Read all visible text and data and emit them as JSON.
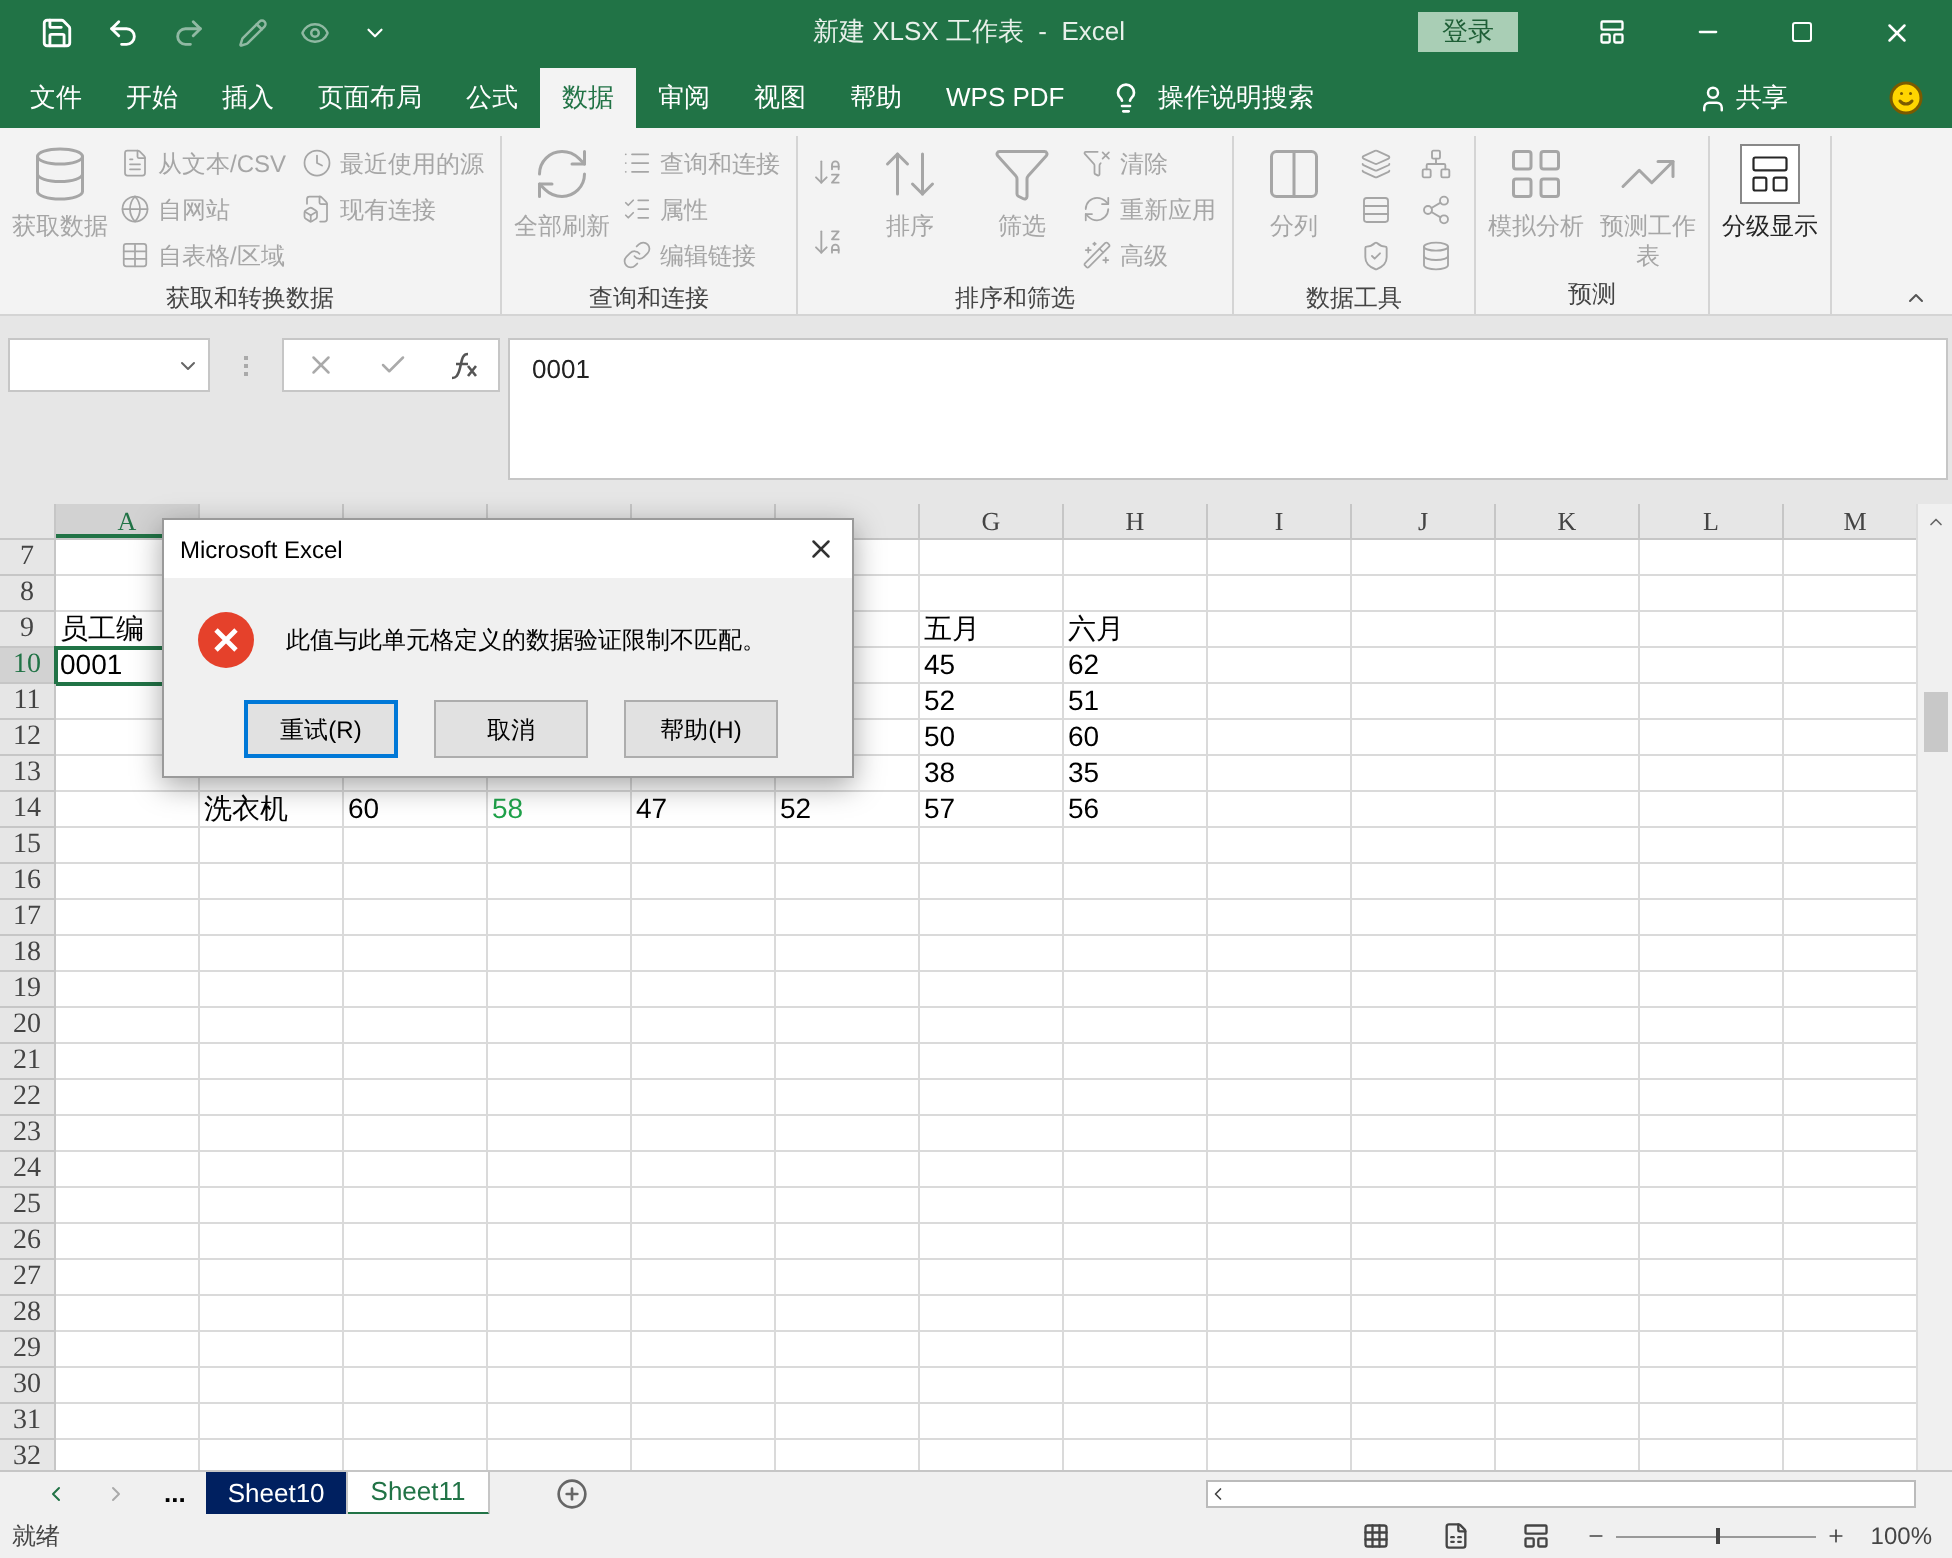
{
  "window": {
    "title": "新建 XLSX 工作表  -  Excel",
    "login": "登录"
  },
  "tabs": [
    {
      "label": "文件",
      "selected": false
    },
    {
      "label": "开始",
      "selected": false
    },
    {
      "label": "插入",
      "selected": false
    },
    {
      "label": "页面布局",
      "selected": false
    },
    {
      "label": "公式",
      "selected": false
    },
    {
      "label": "数据",
      "selected": true
    },
    {
      "label": "审阅",
      "selected": false
    },
    {
      "label": "视图",
      "selected": false
    },
    {
      "label": "帮助",
      "selected": false
    },
    {
      "label": "WPS PDF",
      "selected": false
    }
  ],
  "tell_me": "操作说明搜索",
  "share": "共享",
  "ribbon_groups": [
    {
      "label": "获取和转换数据",
      "items": [
        {
          "kind": "large",
          "label": "获取数据",
          "disabled": true
        },
        {
          "kind": "small",
          "label": "从文本/CSV",
          "disabled": true
        },
        {
          "kind": "small",
          "label": "自网站",
          "disabled": true
        },
        {
          "kind": "small",
          "label": "自表格/区域",
          "disabled": true
        },
        {
          "kind": "small",
          "label": "最近使用的源",
          "disabled": true
        },
        {
          "kind": "small",
          "label": "现有连接",
          "disabled": true
        }
      ]
    },
    {
      "label": "查询和连接",
      "items": [
        {
          "kind": "large",
          "label": "全部刷新",
          "disabled": true
        },
        {
          "kind": "small",
          "label": "查询和连接",
          "disabled": true
        },
        {
          "kind": "small",
          "label": "属性",
          "disabled": true
        },
        {
          "kind": "small",
          "label": "编辑链接",
          "disabled": true
        }
      ]
    },
    {
      "label": "排序和筛选",
      "items": [
        {
          "kind": "icon",
          "disabled": true
        },
        {
          "kind": "icon",
          "disabled": true
        },
        {
          "kind": "large",
          "label": "排序",
          "disabled": true
        },
        {
          "kind": "large",
          "label": "筛选",
          "disabled": true
        },
        {
          "kind": "small",
          "label": "清除",
          "disabled": true
        },
        {
          "kind": "small",
          "label": "重新应用",
          "disabled": true
        },
        {
          "kind": "small",
          "label": "高级",
          "disabled": true
        }
      ]
    },
    {
      "label": "数据工具",
      "items": [
        {
          "kind": "large",
          "label": "分列",
          "disabled": true
        },
        {
          "kind": "icon",
          "disabled": true
        },
        {
          "kind": "icon",
          "disabled": true
        },
        {
          "kind": "icon",
          "disabled": true
        },
        {
          "kind": "icon",
          "disabled": true
        },
        {
          "kind": "icon",
          "disabled": true
        },
        {
          "kind": "icon",
          "disabled": true
        }
      ]
    },
    {
      "label": "预测",
      "items": [
        {
          "kind": "large",
          "label": "模拟分析",
          "disabled": true
        },
        {
          "kind": "large",
          "label": "预测工作表",
          "disabled": true
        }
      ]
    },
    {
      "items": [
        {
          "kind": "large",
          "label": "分级显示",
          "disabled": false
        }
      ]
    }
  ],
  "formula_bar": {
    "value": "0001"
  },
  "columns": [
    {
      "label": "A",
      "selected": true
    },
    {
      "selected": false
    },
    {
      "selected": false
    },
    {
      "selected": false
    },
    {
      "selected": false
    },
    {
      "selected": false
    },
    {
      "label": "G",
      "selected": false
    },
    {
      "label": "H",
      "selected": false
    },
    {
      "label": "I",
      "selected": false
    },
    {
      "label": "J",
      "selected": false
    },
    {
      "label": "K",
      "selected": false
    },
    {
      "label": "L",
      "selected": false
    },
    {
      "label": "M",
      "selected": false
    }
  ],
  "rows": [
    {
      "number": "7",
      "selected": false,
      "cells": {}
    },
    {
      "number": "8",
      "selected": false,
      "cells": {}
    },
    {
      "number": "9",
      "selected": false,
      "cells": {
        "A": {
          "text": "员工编",
          "selected": false
        },
        "G": {
          "text": "五月",
          "selected": false
        },
        "H": {
          "text": "六月",
          "selected": false
        }
      }
    },
    {
      "number": "10",
      "selected": true,
      "cells": {
        "A": {
          "text": "0001",
          "selected": true
        },
        "G": {
          "text": "45",
          "selected": false
        },
        "H": {
          "text": "62",
          "selected": false
        }
      }
    },
    {
      "number": "11",
      "selected": false,
      "cells": {
        "G": {
          "text": "52",
          "selected": false
        },
        "H": {
          "text": "51",
          "selected": false
        }
      }
    },
    {
      "number": "12",
      "selected": false,
      "cells": {
        "G": {
          "text": "50",
          "selected": false
        },
        "H": {
          "text": "60",
          "selected": false
        }
      }
    },
    {
      "number": "13",
      "selected": false,
      "cells": {
        "G": {
          "text": "38",
          "selected": false
        },
        "H": {
          "text": "35",
          "selected": false
        }
      }
    },
    {
      "number": "14",
      "selected": false,
      "cells": {
        "B": {
          "text": "洗衣机",
          "selected": false
        },
        "C": {
          "text": "60",
          "selected": false
        },
        "D": {
          "text": "58",
          "selected": false,
          "color": "#1fa24a"
        },
        "E": {
          "text": "47",
          "selected": false
        },
        "F": {
          "text": "52",
          "selected": false
        },
        "G": {
          "text": "57",
          "selected": false
        },
        "H": {
          "text": "56",
          "selected": false
        }
      }
    },
    {
      "number": "15",
      "selected": false,
      "cells": {}
    },
    {
      "number": "16",
      "selected": false,
      "cells": {}
    },
    {
      "number": "17",
      "selected": false,
      "cells": {}
    },
    {
      "number": "18",
      "selected": false,
      "cells": {}
    },
    {
      "number": "19",
      "selected": false,
      "cells": {}
    },
    {
      "number": "20",
      "selected": false,
      "cells": {}
    },
    {
      "number": "21",
      "selected": false,
      "cells": {}
    },
    {
      "number": "22",
      "selected": false,
      "cells": {}
    },
    {
      "number": "23",
      "selected": false,
      "cells": {}
    },
    {
      "number": "24",
      "selected": false,
      "cells": {}
    },
    {
      "number": "25",
      "selected": false,
      "cells": {}
    },
    {
      "number": "26",
      "selected": false,
      "cells": {}
    },
    {
      "number": "27",
      "selected": false,
      "cells": {}
    },
    {
      "number": "28",
      "selected": false,
      "cells": {}
    },
    {
      "number": "29",
      "selected": false,
      "cells": {}
    },
    {
      "number": "30",
      "selected": false,
      "cells": {}
    },
    {
      "number": "31",
      "selected": false,
      "cells": {}
    },
    {
      "number": "32",
      "selected": false,
      "cells": {}
    }
  ],
  "dialog": {
    "title": "Microsoft Excel",
    "message": "此值与此单元格定义的数据验证限制不匹配。",
    "buttons": [
      {
        "label": "重试(R)",
        "selected": true
      },
      {
        "label": "取消",
        "selected": false
      },
      {
        "label": "帮助(H)",
        "selected": false
      }
    ]
  },
  "sheet_tabs": {
    "more": "...",
    "tabs": [
      {
        "label": "Sheet10",
        "selected": false,
        "color": "#002060"
      },
      {
        "label": "Sheet11",
        "selected": true
      }
    ]
  },
  "status_bar": {
    "status": "就绪",
    "zoom": "100%",
    "zoom_slider": {
      "level": 0.5
    }
  }
}
